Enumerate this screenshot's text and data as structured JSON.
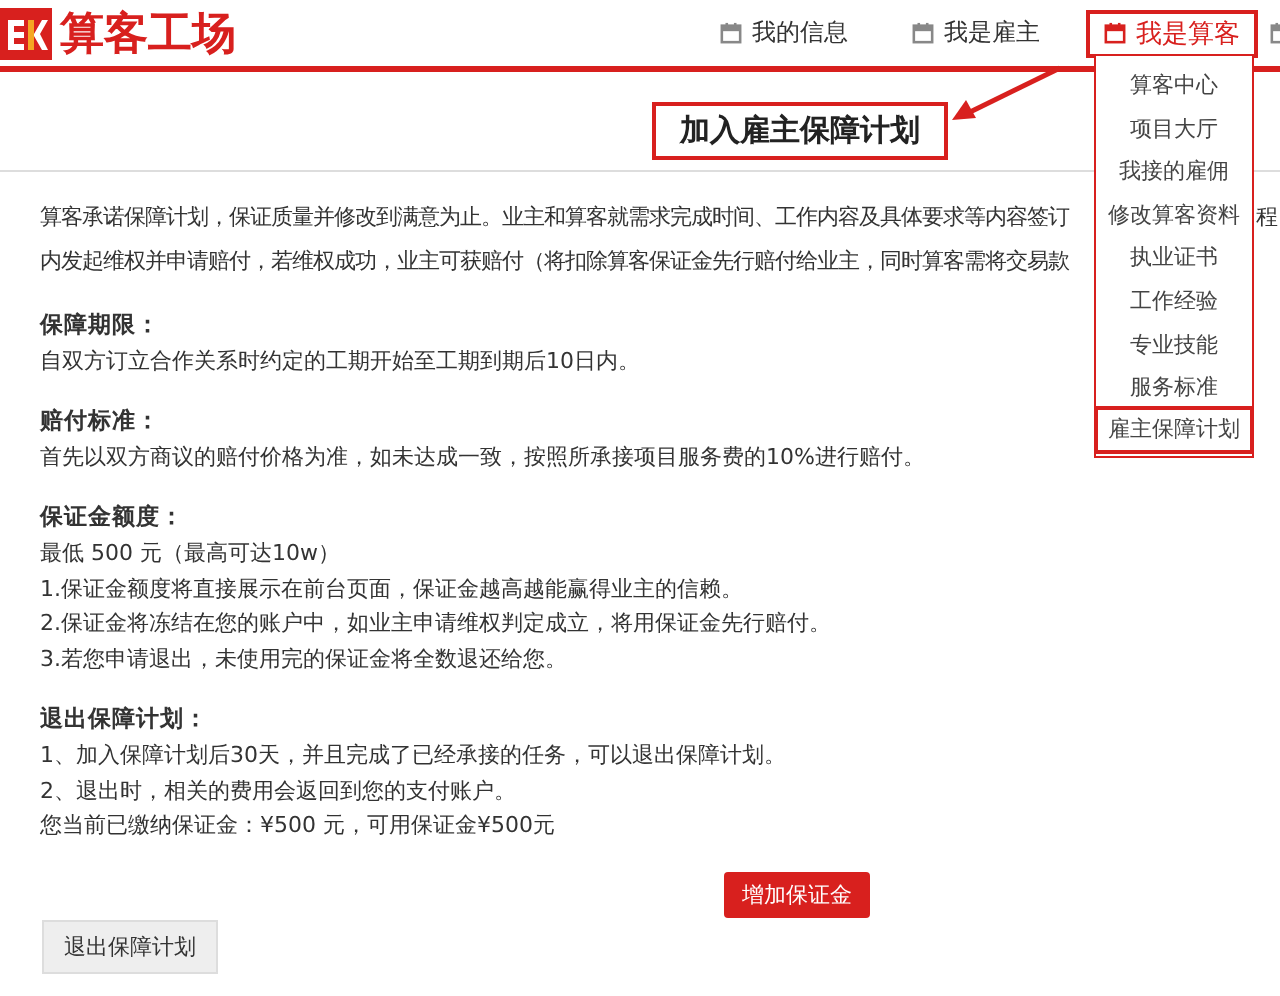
{
  "header": {
    "logo": "算客工场",
    "nav": [
      {
        "label": "我的信息",
        "selected": false
      },
      {
        "label": "我是雇主",
        "selected": false
      },
      {
        "label": "我是算客",
        "selected": true
      }
    ]
  },
  "dropdown": {
    "items": [
      {
        "label": "算客中心",
        "marked": false
      },
      {
        "label": "项目大厅",
        "marked": false
      },
      {
        "label": "我接的雇佣",
        "marked": false
      },
      {
        "label": "修改算客资料",
        "marked": false
      },
      {
        "label": "执业证书",
        "marked": false
      },
      {
        "label": "工作经验",
        "marked": false
      },
      {
        "label": "专业技能",
        "marked": false
      },
      {
        "label": "服务标准",
        "marked": false
      },
      {
        "label": "雇主保障计划",
        "marked": true
      }
    ]
  },
  "page_title": "加入雇主保障计划",
  "intro": [
    {
      "text": "算客承诺保障计划，保证质量并修改到满意为止。业主和算客就需求完成时间、工作内容及具体要求等内容签订",
      "tail": "程"
    },
    {
      "text": "内发起维权并申请赔付，若维权成功，业主可获赔付（将扣除算客保证金先行赔付给业主，同时算客需将交易款"
    }
  ],
  "sections": [
    {
      "heading": "保障期限：",
      "lines": [
        "自双方订立合作关系时约定的工期开始至工期到期后10日内。"
      ]
    },
    {
      "heading": "赔付标准：",
      "lines": [
        "首先以双方商议的赔付价格为准，如未达成一致，按照所承接项目服务费的10%进行赔付。"
      ]
    },
    {
      "heading": "保证金额度：",
      "lines": [
        "最低 500 元（最高可达10w）",
        "1.保证金额度将直接展示在前台页面，保证金越高越能赢得业主的信赖。",
        "2.保证金将冻结在您的账户中，如业主申请维权判定成立，将用保证金先行赔付。",
        "3.若您申请退出，未使用完的保证金将全数退还给您。"
      ]
    },
    {
      "heading": "退出保障计划：",
      "lines": [
        "1、加入保障计划后30天，并且完成了已经承接的任务，可以退出保障计划。",
        "2、退出时，相关的费用会返回到您的支付账户。",
        "您当前已缴纳保证金：¥500 元，可用保证金¥500元"
      ]
    }
  ],
  "buttons": [
    {
      "label": "增加保证金",
      "kind": "primary"
    },
    {
      "label": "退出保障计划",
      "kind": "secondary"
    }
  ]
}
